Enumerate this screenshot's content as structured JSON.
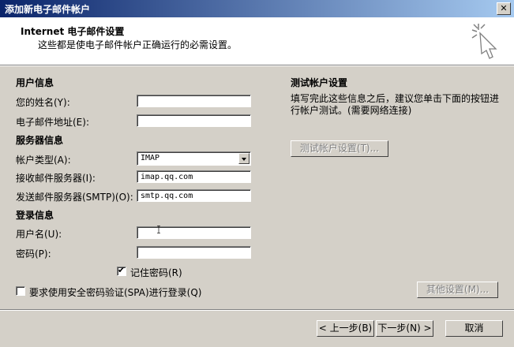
{
  "window": {
    "title": "添加新电子邮件帐户",
    "close_glyph": "✕"
  },
  "header": {
    "title": "Internet 电子邮件设置",
    "subtitle": "这些都是使电子邮件帐户正确运行的必需设置。"
  },
  "user_info": {
    "section": "用户信息",
    "name_label": "您的姓名(Y):",
    "name_value": "",
    "email_label": "电子邮件地址(E):",
    "email_value": ""
  },
  "server_info": {
    "section": "服务器信息",
    "account_type_label": "帐户类型(A):",
    "account_type_value": "IMAP",
    "incoming_label": "接收邮件服务器(I):",
    "incoming_value": "imap.qq.com",
    "outgoing_label": "发送邮件服务器(SMTP)(O):",
    "outgoing_value": "smtp.qq.com"
  },
  "login_info": {
    "section": "登录信息",
    "username_label": "用户名(U):",
    "username_value": "",
    "password_label": "密码(P):",
    "password_value": "",
    "remember_label": "记住密码(R)",
    "remember_checked": true,
    "spa_label": "要求使用安全密码验证(SPA)进行登录(Q)",
    "spa_checked": false
  },
  "test": {
    "section": "测试帐户设置",
    "description": "填写完此这些信息之后，建议您单击下面的按钮进行帐户测试。(需要网络连接)",
    "button": "测试帐户设置(T)..."
  },
  "more_settings_button": "其他设置(M)...",
  "footer": {
    "back": "< 上一步(B)",
    "next": "下一步(N) >",
    "cancel": "取消"
  }
}
